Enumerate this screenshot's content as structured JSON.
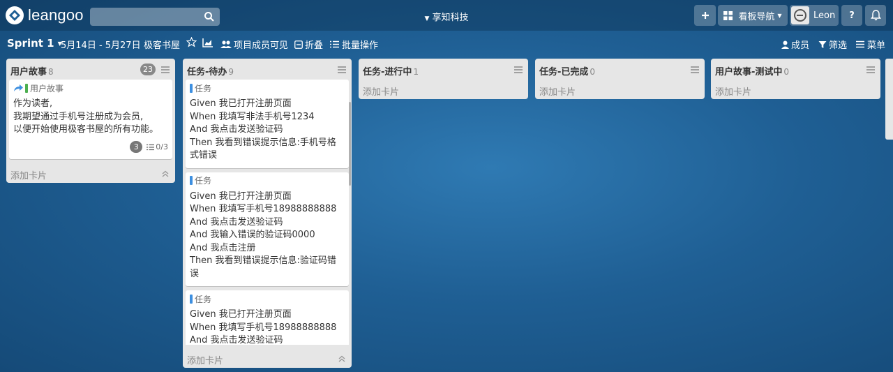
{
  "app": {
    "logo_text": "leangoo",
    "org_name": "享知科技",
    "user_name": "Leon",
    "board_nav_label": "看板导航",
    "help_label": "?"
  },
  "board_bar": {
    "sprint": "Sprint 1",
    "date_range": "5月14日 - 5月27日",
    "project": "极客书屋",
    "visibility": "项目成员可见",
    "collapse": "折叠",
    "batch": "批量操作",
    "members": "成员",
    "filter": "筛选",
    "menu": "菜单"
  },
  "lists": [
    {
      "name": "用户故事",
      "count": "8",
      "badge": "23",
      "add_label": "添加卡片",
      "cards": [
        {
          "type_label": "用户故事",
          "body": "作为读者,\n我期望通过手机号注册成为会员,\n以便开始使用极客书屋的所有功能。",
          "points": "3",
          "checklist": "0/3"
        }
      ]
    },
    {
      "name": "任务-待办",
      "count": "9",
      "add_label": "添加卡片",
      "cards": [
        {
          "type_label": "任务",
          "body": "Given 我已打开注册页面\nWhen 我填写非法手机号1234\nAnd 我点击发送验证码\nThen 我看到错误提示信息:手机号格式错误"
        },
        {
          "type_label": "任务",
          "body": "Given 我已打开注册页面\nWhen 我填写手机号18988888888\nAnd 我点击发送验证码\nAnd 我输入错误的验证码0000\nAnd 我点击注册\nThen 我看到错误提示信息:验证码错误"
        },
        {
          "type_label": "任务",
          "body": "Given 我已打开注册页面\nWhen 我填写手机号18988888888\nAnd 我点击发送验证码"
        }
      ]
    },
    {
      "name": "任务-进行中",
      "count": "1",
      "add_label": "添加卡片"
    },
    {
      "name": "任务-已完成",
      "count": "0",
      "add_label": "添加卡片"
    },
    {
      "name": "用户故事-测试中",
      "count": "0",
      "add_label": "添加卡片"
    }
  ],
  "colors": {
    "story_type": "#4caf50",
    "task_type": "#3d8fe0",
    "background": "#1f5f94"
  }
}
